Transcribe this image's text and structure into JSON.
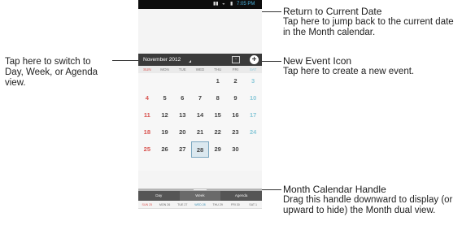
{
  "annotations": {
    "left": "Tap here to switch to Day, Week, or Agenda view.",
    "return_title": "Return to Current Date",
    "return_desc": "Tap here to jump back to the current date in the Month calendar.",
    "new_title": "New Event Icon",
    "new_desc": "Tap here to create a new event.",
    "handle_title": "Month Calendar Handle",
    "handle_desc": "Drag this handle downward to display (or upward to hide) the Month dual view."
  },
  "status_bar": {
    "time": "7:05 PM"
  },
  "header": {
    "month_label": "November 2012",
    "today_icon": "calendar-today-icon",
    "new_icon": "plus-circle-icon"
  },
  "days_of_week": [
    "SUN",
    "MON",
    "TUE",
    "WED",
    "THU",
    "FRI",
    "SAT"
  ],
  "calendar": {
    "weeks": [
      [
        "",
        "",
        "",
        "",
        "1",
        "2",
        "3"
      ],
      [
        "4",
        "5",
        "6",
        "7",
        "8",
        "9",
        "10"
      ],
      [
        "11",
        "12",
        "13",
        "14",
        "15",
        "16",
        "17"
      ],
      [
        "18",
        "19",
        "20",
        "21",
        "22",
        "23",
        "24"
      ],
      [
        "25",
        "26",
        "27",
        "28",
        "29",
        "30",
        ""
      ]
    ],
    "today": "28"
  },
  "view_tabs": [
    "Day",
    "Week",
    "Agenda"
  ],
  "week_strip": [
    "SUN 25",
    "MON 26",
    "TUE 27",
    "WED 28",
    "THU 29",
    "FRI 30",
    "SAT 1"
  ],
  "colors": {
    "sunday": "#d9534f",
    "saturday": "#8bc9d9",
    "header": "#3a3a3a",
    "today": "#dbe8ef"
  }
}
